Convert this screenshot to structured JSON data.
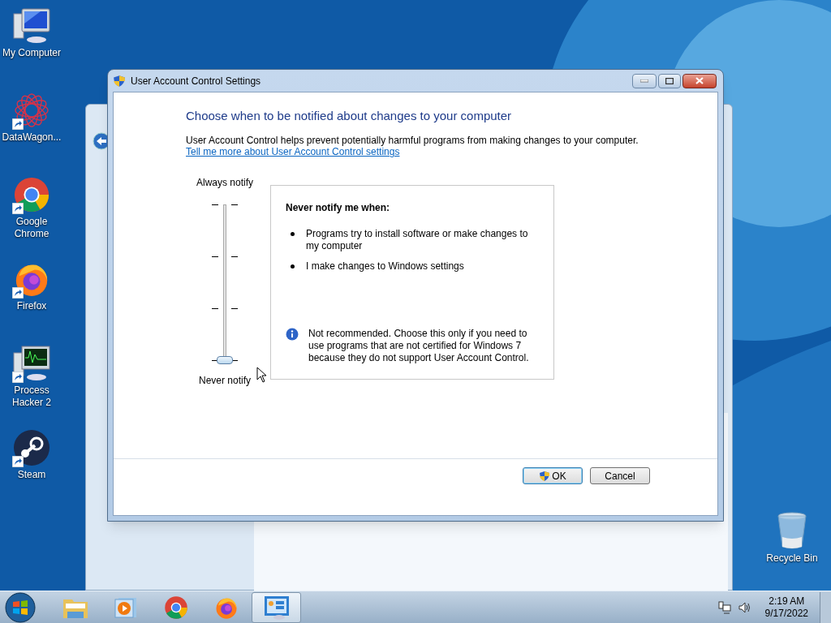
{
  "desktop_icons": [
    {
      "kind": "computer",
      "label": "My Computer",
      "shortcut": false
    },
    {
      "kind": "datawagon",
      "label": "DataWagon...",
      "shortcut": true
    },
    {
      "kind": "chrome",
      "label": "Google Chrome",
      "shortcut": true
    },
    {
      "kind": "firefox",
      "label": "Firefox",
      "shortcut": true
    },
    {
      "kind": "monitor",
      "label": "Process Hacker 2",
      "shortcut": true
    },
    {
      "kind": "steam",
      "label": "Steam",
      "shortcut": true
    }
  ],
  "recycle_bin": {
    "label": "Recycle Bin"
  },
  "dialog": {
    "title": "User Account Control Settings",
    "heading": "Choose when to be notified about changes to your computer",
    "description": "User Account Control helps prevent potentially harmful programs from making changes to your computer.",
    "link": "Tell me more about User Account Control settings",
    "slider": {
      "top_label": "Always notify",
      "bottom_label": "Never notify",
      "level": 0
    },
    "info_box": {
      "title": "Never notify me when:",
      "bullets": [
        "Programs try to install software or make changes to my computer",
        "I make changes to Windows settings"
      ],
      "note": "Not recommended. Choose this only if you need to use programs that are not certified for Windows 7 because they do not support User Account Control."
    },
    "buttons": [
      {
        "label": "OK",
        "kind": "shield",
        "focused": true
      },
      {
        "label": "Cancel",
        "kind": "plain",
        "focused": false
      }
    ]
  },
  "taskbar": {
    "items": [
      {
        "kind": "explorer",
        "selected": false
      },
      {
        "kind": "media",
        "selected": false
      },
      {
        "kind": "chrome",
        "selected": false
      },
      {
        "kind": "firefox",
        "selected": false
      },
      {
        "kind": "control",
        "selected": true
      }
    ],
    "time": "2:19 AM",
    "date": "9/17/2022"
  }
}
